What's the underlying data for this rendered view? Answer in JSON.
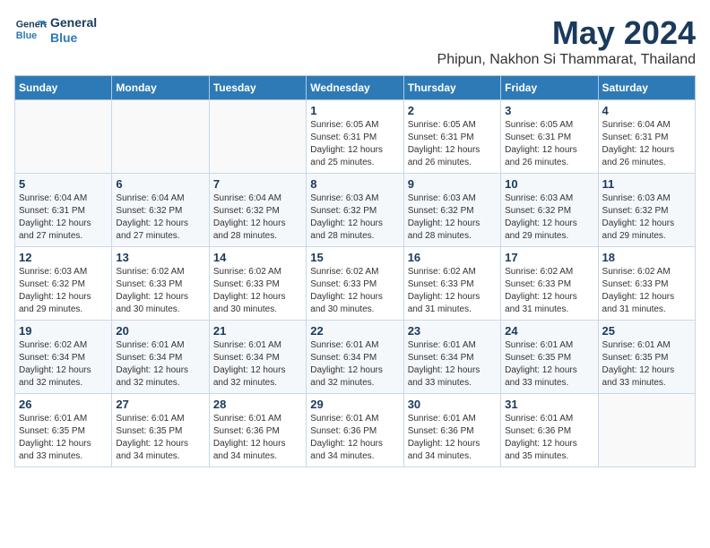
{
  "logo": {
    "line1": "General",
    "line2": "Blue"
  },
  "title": "May 2024",
  "subtitle": "Phipun, Nakhon Si Thammarat, Thailand",
  "header": {
    "days": [
      "Sunday",
      "Monday",
      "Tuesday",
      "Wednesday",
      "Thursday",
      "Friday",
      "Saturday"
    ]
  },
  "weeks": [
    [
      {
        "day": "",
        "info": ""
      },
      {
        "day": "",
        "info": ""
      },
      {
        "day": "",
        "info": ""
      },
      {
        "day": "1",
        "info": "Sunrise: 6:05 AM\nSunset: 6:31 PM\nDaylight: 12 hours\nand 25 minutes."
      },
      {
        "day": "2",
        "info": "Sunrise: 6:05 AM\nSunset: 6:31 PM\nDaylight: 12 hours\nand 26 minutes."
      },
      {
        "day": "3",
        "info": "Sunrise: 6:05 AM\nSunset: 6:31 PM\nDaylight: 12 hours\nand 26 minutes."
      },
      {
        "day": "4",
        "info": "Sunrise: 6:04 AM\nSunset: 6:31 PM\nDaylight: 12 hours\nand 26 minutes."
      }
    ],
    [
      {
        "day": "5",
        "info": "Sunrise: 6:04 AM\nSunset: 6:31 PM\nDaylight: 12 hours\nand 27 minutes."
      },
      {
        "day": "6",
        "info": "Sunrise: 6:04 AM\nSunset: 6:32 PM\nDaylight: 12 hours\nand 27 minutes."
      },
      {
        "day": "7",
        "info": "Sunrise: 6:04 AM\nSunset: 6:32 PM\nDaylight: 12 hours\nand 28 minutes."
      },
      {
        "day": "8",
        "info": "Sunrise: 6:03 AM\nSunset: 6:32 PM\nDaylight: 12 hours\nand 28 minutes."
      },
      {
        "day": "9",
        "info": "Sunrise: 6:03 AM\nSunset: 6:32 PM\nDaylight: 12 hours\nand 28 minutes."
      },
      {
        "day": "10",
        "info": "Sunrise: 6:03 AM\nSunset: 6:32 PM\nDaylight: 12 hours\nand 29 minutes."
      },
      {
        "day": "11",
        "info": "Sunrise: 6:03 AM\nSunset: 6:32 PM\nDaylight: 12 hours\nand 29 minutes."
      }
    ],
    [
      {
        "day": "12",
        "info": "Sunrise: 6:03 AM\nSunset: 6:32 PM\nDaylight: 12 hours\nand 29 minutes."
      },
      {
        "day": "13",
        "info": "Sunrise: 6:02 AM\nSunset: 6:33 PM\nDaylight: 12 hours\nand 30 minutes."
      },
      {
        "day": "14",
        "info": "Sunrise: 6:02 AM\nSunset: 6:33 PM\nDaylight: 12 hours\nand 30 minutes."
      },
      {
        "day": "15",
        "info": "Sunrise: 6:02 AM\nSunset: 6:33 PM\nDaylight: 12 hours\nand 30 minutes."
      },
      {
        "day": "16",
        "info": "Sunrise: 6:02 AM\nSunset: 6:33 PM\nDaylight: 12 hours\nand 31 minutes."
      },
      {
        "day": "17",
        "info": "Sunrise: 6:02 AM\nSunset: 6:33 PM\nDaylight: 12 hours\nand 31 minutes."
      },
      {
        "day": "18",
        "info": "Sunrise: 6:02 AM\nSunset: 6:33 PM\nDaylight: 12 hours\nand 31 minutes."
      }
    ],
    [
      {
        "day": "19",
        "info": "Sunrise: 6:02 AM\nSunset: 6:34 PM\nDaylight: 12 hours\nand 32 minutes."
      },
      {
        "day": "20",
        "info": "Sunrise: 6:01 AM\nSunset: 6:34 PM\nDaylight: 12 hours\nand 32 minutes."
      },
      {
        "day": "21",
        "info": "Sunrise: 6:01 AM\nSunset: 6:34 PM\nDaylight: 12 hours\nand 32 minutes."
      },
      {
        "day": "22",
        "info": "Sunrise: 6:01 AM\nSunset: 6:34 PM\nDaylight: 12 hours\nand 32 minutes."
      },
      {
        "day": "23",
        "info": "Sunrise: 6:01 AM\nSunset: 6:34 PM\nDaylight: 12 hours\nand 33 minutes."
      },
      {
        "day": "24",
        "info": "Sunrise: 6:01 AM\nSunset: 6:35 PM\nDaylight: 12 hours\nand 33 minutes."
      },
      {
        "day": "25",
        "info": "Sunrise: 6:01 AM\nSunset: 6:35 PM\nDaylight: 12 hours\nand 33 minutes."
      }
    ],
    [
      {
        "day": "26",
        "info": "Sunrise: 6:01 AM\nSunset: 6:35 PM\nDaylight: 12 hours\nand 33 minutes."
      },
      {
        "day": "27",
        "info": "Sunrise: 6:01 AM\nSunset: 6:35 PM\nDaylight: 12 hours\nand 34 minutes."
      },
      {
        "day": "28",
        "info": "Sunrise: 6:01 AM\nSunset: 6:36 PM\nDaylight: 12 hours\nand 34 minutes."
      },
      {
        "day": "29",
        "info": "Sunrise: 6:01 AM\nSunset: 6:36 PM\nDaylight: 12 hours\nand 34 minutes."
      },
      {
        "day": "30",
        "info": "Sunrise: 6:01 AM\nSunset: 6:36 PM\nDaylight: 12 hours\nand 34 minutes."
      },
      {
        "day": "31",
        "info": "Sunrise: 6:01 AM\nSunset: 6:36 PM\nDaylight: 12 hours\nand 35 minutes."
      },
      {
        "day": "",
        "info": ""
      }
    ]
  ]
}
